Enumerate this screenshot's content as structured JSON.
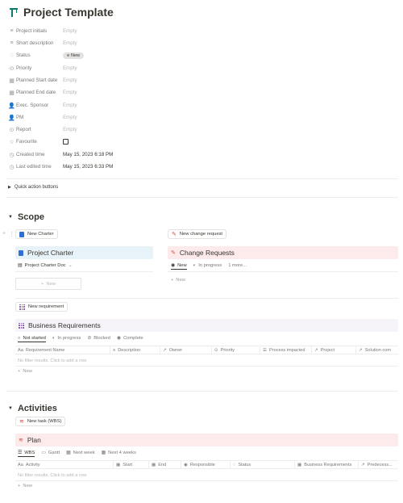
{
  "page": {
    "title": "Project Template",
    "properties": [
      {
        "icon": "text-lines-icon",
        "glyph": "≡",
        "name": "Project initials",
        "value": "Empty"
      },
      {
        "icon": "text-lines-icon",
        "glyph": "≡",
        "name": "Short description",
        "value": "Empty"
      },
      {
        "icon": "status-icon",
        "glyph": "◌",
        "name": "Status",
        "value": "New"
      },
      {
        "icon": "priority-icon",
        "glyph": "⊙",
        "name": "Priority",
        "value": "Empty"
      },
      {
        "icon": "calendar-icon",
        "glyph": "▦",
        "name": "Planned Start date",
        "value": "Empty"
      },
      {
        "icon": "calendar-icon",
        "glyph": "▦",
        "name": "Planned End date",
        "value": "Empty"
      },
      {
        "icon": "person-icon",
        "glyph": "👤",
        "name": "Exec. Sponsor",
        "value": "Empty"
      },
      {
        "icon": "person-icon",
        "glyph": "👤",
        "name": "PM",
        "value": "Empty"
      },
      {
        "icon": "report-icon",
        "glyph": "⊙",
        "name": "Report",
        "value": "Empty"
      },
      {
        "icon": "star-icon",
        "glyph": "☆",
        "name": "Favourite",
        "value": ""
      },
      {
        "icon": "clock-icon",
        "glyph": "◷",
        "name": "Created time",
        "value": "May 15, 2023 6:18 PM"
      },
      {
        "icon": "clock-icon",
        "glyph": "◷",
        "name": "Last edited time",
        "value": "May 15, 2023 6:33 PM"
      }
    ]
  },
  "quick_actions": {
    "label": "Quick action buttons"
  },
  "scope": {
    "heading": "Scope",
    "new_charter_label": "New Charter",
    "new_change_request_label": "New change request",
    "charter": {
      "title": "Project Charter",
      "view_label": "Project Charter Doc",
      "new_label": "New"
    },
    "change_requests": {
      "title": "Change Requests",
      "tabs": [
        "New",
        "In progress",
        "1 more..."
      ],
      "new_label": "New"
    },
    "new_requirement_label": "New requirement",
    "business_requirements": {
      "title": "Business Requirements",
      "tabs": [
        "Not started",
        "In progress",
        "Blocked",
        "Complete"
      ],
      "columns": [
        "Requirement Name",
        "Description",
        "Owner",
        "Priority",
        "Process impacted",
        "Project",
        "Solution com"
      ],
      "empty_text": "No filter results. Click to add a row.",
      "new_label": "New"
    }
  },
  "activities": {
    "heading": "Activities",
    "new_task_label": "New task (WBS)",
    "plan": {
      "title": "Plan",
      "tabs": [
        "WBS",
        "Gantt",
        "Next week",
        "Next 4 weeks"
      ],
      "columns": [
        "Activity",
        "Start",
        "End",
        "Responsible",
        "Status",
        "Business Requirements",
        "Predecess..."
      ],
      "empty_text": "No filter results. Click to add a row.",
      "new_label": "New"
    }
  },
  "colors": {
    "charter_bg": "#e7f3f8",
    "change_bg": "#fdebec",
    "req_bg": "#f6f3f9",
    "plan_bg": "#fdebec"
  }
}
